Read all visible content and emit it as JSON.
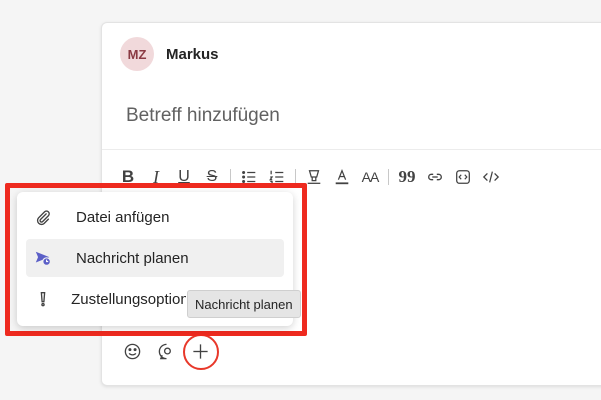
{
  "compose": {
    "user": {
      "initials": "MZ",
      "name": "Markus"
    },
    "subject_placeholder": "Betreff hinzufügen"
  },
  "toolbar": {
    "bold": "B",
    "italic": "I",
    "underline": "U",
    "strike": "S",
    "font_size": "AA",
    "quote": "99"
  },
  "menu": {
    "items": [
      {
        "label": "Datei anfügen",
        "icon": "paperclip-icon"
      },
      {
        "label": "Nachricht planen",
        "icon": "schedule-send-icon"
      },
      {
        "label": "Zustellungsoptionen",
        "icon": "exclamation-icon"
      }
    ]
  },
  "tooltip": "Nachricht planen",
  "colors": {
    "highlight": "#ee2a1f",
    "avatar_bg": "#f1d9db",
    "avatar_text": "#8a3a43",
    "schedule_icon": "#5b5fc7"
  }
}
